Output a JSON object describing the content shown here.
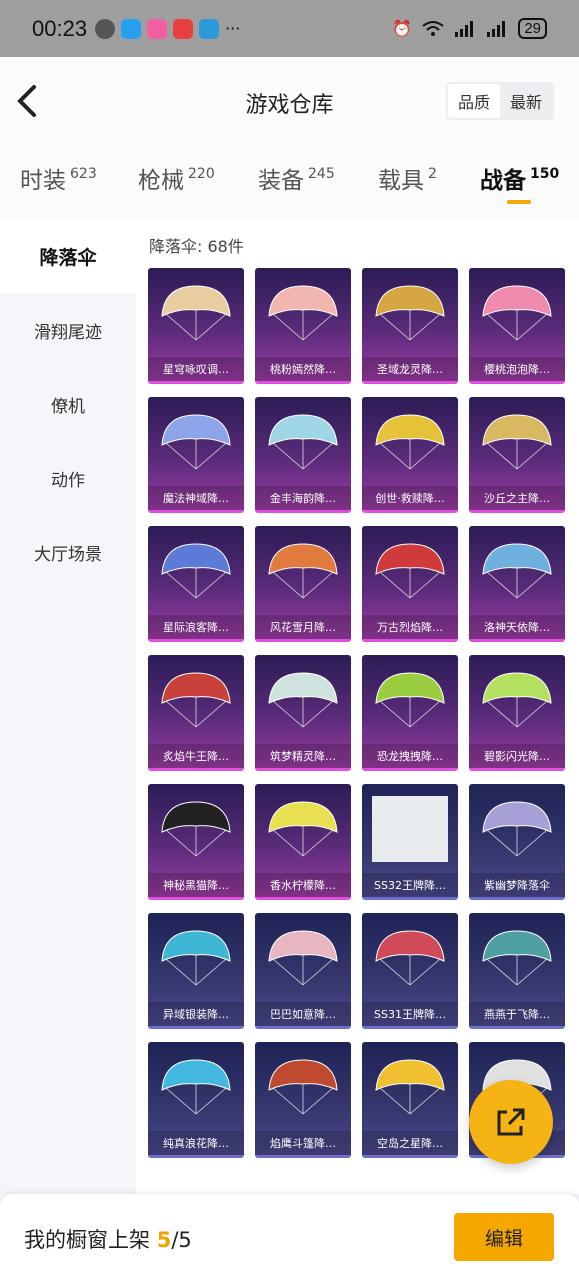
{
  "status": {
    "time": "00:23",
    "battery": "29"
  },
  "header": {
    "title": "游戏仓库",
    "sort_quality": "品质",
    "sort_latest": "最新"
  },
  "tabs": [
    {
      "label": "时装",
      "count": "623"
    },
    {
      "label": "枪械",
      "count": "220"
    },
    {
      "label": "装备",
      "count": "245"
    },
    {
      "label": "载具",
      "count": "2"
    },
    {
      "label": "战备",
      "count": "150"
    }
  ],
  "sidebar": [
    "降落伞",
    "滑翔尾迹",
    "僚机",
    "动作",
    "大厅场景"
  ],
  "main": {
    "count_label": "降落伞: 68件"
  },
  "items": [
    {
      "name": "星穹咏叹调…",
      "rarity": "purple",
      "color": "#e7cda0"
    },
    {
      "name": "桃粉嫣然降…",
      "rarity": "purple",
      "color": "#f2b6b0"
    },
    {
      "name": "圣域龙灵降…",
      "rarity": "purple",
      "color": "#d6a640"
    },
    {
      "name": "樱桃泡泡降…",
      "rarity": "purple",
      "color": "#f08bb0"
    },
    {
      "name": "魔法神域降…",
      "rarity": "purple",
      "color": "#8ea4e8"
    },
    {
      "name": "金丰海韵降…",
      "rarity": "purple",
      "color": "#9fd6e6"
    },
    {
      "name": "创世·救赎降…",
      "rarity": "purple",
      "color": "#e6c23a"
    },
    {
      "name": "沙丘之主降…",
      "rarity": "purple",
      "color": "#d8b860"
    },
    {
      "name": "星际浪客降…",
      "rarity": "purple",
      "color": "#5c7ad8"
    },
    {
      "name": "风花雪月降…",
      "rarity": "purple",
      "color": "#e27a3e"
    },
    {
      "name": "万古烈焰降…",
      "rarity": "purple",
      "color": "#d03a3a"
    },
    {
      "name": "洛神天依降…",
      "rarity": "purple",
      "color": "#6fb0e0"
    },
    {
      "name": "炙焰牛王降…",
      "rarity": "purple",
      "color": "#c8413a"
    },
    {
      "name": "筑梦精灵降…",
      "rarity": "purple",
      "color": "#cfe3de"
    },
    {
      "name": "恐龙拽拽降…",
      "rarity": "purple",
      "color": "#9acd40"
    },
    {
      "name": "碧影闪光降…",
      "rarity": "purple",
      "color": "#b4e060"
    },
    {
      "name": "神秘黑猫降…",
      "rarity": "purple",
      "color": "#222222"
    },
    {
      "name": "香水柠檬降…",
      "rarity": "purple",
      "color": "#e8e050"
    },
    {
      "name": "SS32王牌降…",
      "rarity": "placeholder",
      "color": "#d8dde2"
    },
    {
      "name": "紫幽梦降落伞",
      "rarity": "blue",
      "color": "#a7a0d6"
    },
    {
      "name": "异域银装降…",
      "rarity": "blue",
      "color": "#3fb6d6"
    },
    {
      "name": "巴巴如意降…",
      "rarity": "blue",
      "color": "#e8b6c0"
    },
    {
      "name": "SS31王牌降…",
      "rarity": "blue",
      "color": "#d04a5a"
    },
    {
      "name": "燕燕于飞降…",
      "rarity": "blue",
      "color": "#4fa0a0"
    },
    {
      "name": "纯真浪花降…",
      "rarity": "blue",
      "color": "#43b8e0"
    },
    {
      "name": "焰鹰斗篷降…",
      "rarity": "blue",
      "color": "#c04a30"
    },
    {
      "name": "空岛之星降…",
      "rarity": "blue",
      "color": "#f0c030"
    },
    {
      "name": "",
      "rarity": "blue",
      "color": "#e0e0e0"
    }
  ],
  "bottom": {
    "label": "我的橱窗上架",
    "current": "5",
    "total": "/5",
    "edit": "编辑"
  }
}
